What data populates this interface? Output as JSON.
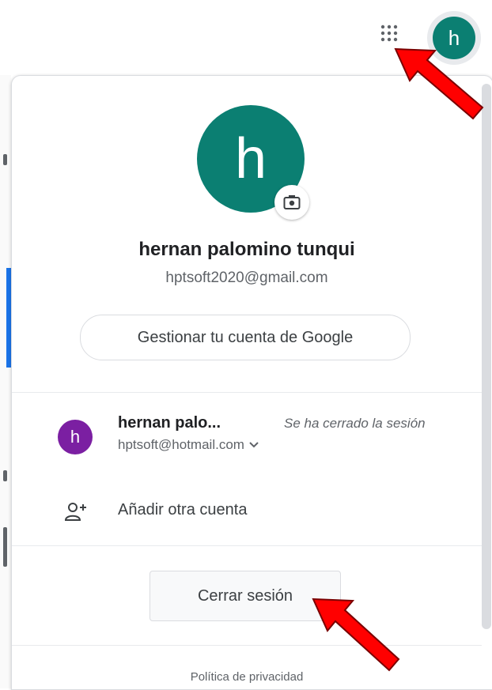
{
  "topbar": {
    "apps_icon": "apps-grid-icon",
    "avatar_letter": "h"
  },
  "account_panel": {
    "avatar_letter": "h",
    "avatar_color": "#0b7f72",
    "camera_icon": "camera-icon",
    "name": "hernan palomino tunqui",
    "email": "hptsoft2020@gmail.com",
    "manage_button": "Gestionar tu cuenta de Google",
    "other_account": {
      "avatar_letter": "h",
      "avatar_color": "#7b1fa2",
      "name": "hernan palo...",
      "status": "Se ha cerrado la sesión",
      "email": "hptsoft@hotmail.com",
      "expand_icon": "chevron-down-icon"
    },
    "add_account": {
      "label": "Añadir otra cuenta",
      "icon": "add-person-icon"
    },
    "sign_out_button": "Cerrar sesión",
    "privacy_link": "Política de privacidad"
  },
  "annotations": {
    "arrow_color": "#ff0000"
  }
}
